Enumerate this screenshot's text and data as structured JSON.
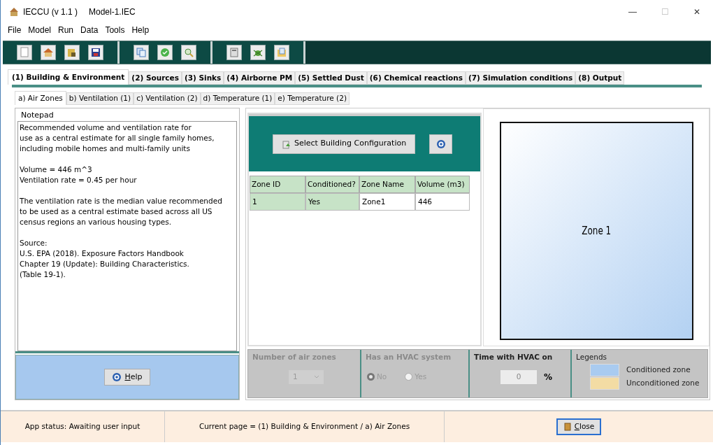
{
  "window": {
    "title": "IECCU (v 1.1 )",
    "file": "Model-1.IEC",
    "controls": [
      "—",
      "☐",
      "✕"
    ]
  },
  "menu": [
    "File",
    "Model",
    "Run",
    "Data",
    "Tools",
    "Help"
  ],
  "tabs": [
    {
      "label": "(1) Building & Environment",
      "selected": true
    },
    {
      "label": "(2) Sources",
      "selected": false
    },
    {
      "label": "(3) Sinks",
      "selected": false
    },
    {
      "label": "(4) Airborne PM",
      "selected": false
    },
    {
      "label": "(5) Settled Dust",
      "selected": false
    },
    {
      "label": "(6) Chemical reactions",
      "selected": false
    },
    {
      "label": "(7) Simulation conditions",
      "selected": false
    },
    {
      "label": "(8) Output",
      "selected": false
    }
  ],
  "subtabs": [
    {
      "label": "a) Air Zones",
      "selected": true
    },
    {
      "label": "b) Ventilation (1)",
      "selected": false
    },
    {
      "label": "c) Ventilation (2)",
      "selected": false
    },
    {
      "label": "d) Temperature (1)",
      "selected": false
    },
    {
      "label": "e) Temperature (2)",
      "selected": false
    }
  ],
  "notepad": {
    "title": "Notepad",
    "paragraphs": [
      [
        "Recommended volume and ventilation rate for",
        "use as a central estimate for all single family homes,",
        "including mobile homes and multi-family units"
      ],
      [
        "Volume = 446 m^3",
        "Ventilation rate = 0.45 per hour"
      ],
      [
        "The ventilation rate is the median value recommended",
        "to be used as a central estimate based across all US",
        "census regions an various housing types."
      ],
      [
        "Source:",
        "U.S. EPA (2018). Exposure Factors Handbook",
        "Chapter 19 (Update): Building Characteristics.",
        "(Table 19-1)."
      ]
    ]
  },
  "help_button": "Help",
  "select_button": "Select Building Configuration",
  "table": {
    "columns": [
      {
        "label": "Zone ID",
        "editable": false
      },
      {
        "label": "Conditioned?",
        "editable": false
      },
      {
        "label": "Zone Name",
        "editable": true
      },
      {
        "label": "Volume (m3)",
        "editable": true
      }
    ],
    "rows": [
      [
        "1",
        "Yes",
        "Zone1",
        "446"
      ]
    ]
  },
  "zones": [
    {
      "label": "Zone 1",
      "conditioned": true
    }
  ],
  "air_zones": {
    "title": "Number of air zones",
    "value": "1",
    "disabled": true
  },
  "hvac": {
    "title": "Has an HVAC system",
    "disabled": true,
    "options": [
      {
        "label": "No",
        "selected": true
      },
      {
        "label": "Yes",
        "selected": false
      }
    ]
  },
  "hvac_time": {
    "title": "Time with HVAC on",
    "value": "0",
    "unit": "%"
  },
  "legends": {
    "title": "Legends",
    "items": [
      {
        "label": "Conditioned zone",
        "color": "#a9cbf0"
      },
      {
        "label": "Unconditioned zone",
        "color": "#f3dca4"
      }
    ]
  },
  "status_bar": {
    "status": "App status: Awaiting user input",
    "page": "Current page = (1) Building & Environment / a) Air Zones",
    "close_button": "Close"
  }
}
